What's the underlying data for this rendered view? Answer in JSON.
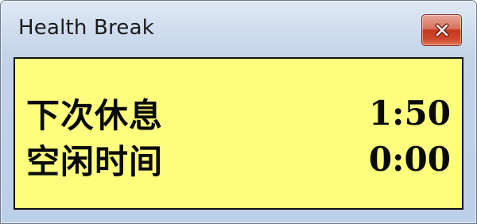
{
  "window": {
    "title": "Health Break",
    "close_icon": "close-icon"
  },
  "panel": {
    "background_color": "#fefe7e",
    "next_break": {
      "label": "下次休息",
      "value": "1:50"
    },
    "idle_time": {
      "label": "空闲时间",
      "value": "0:00"
    }
  }
}
